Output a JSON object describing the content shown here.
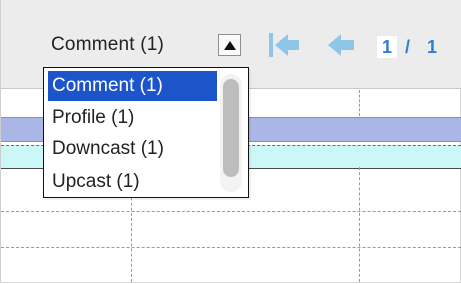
{
  "toolbar": {
    "filter_select": {
      "value": "Comment (1)"
    },
    "nav": {
      "current_page": "1",
      "separator": "/",
      "total_pages": "1"
    }
  },
  "dropdown": {
    "options": [
      "Comment (1)",
      "Profile (1)",
      "Downcast (1)",
      "Upcast (1)"
    ],
    "selected_index": 0
  },
  "colors": {
    "header_row": "#aab6e6",
    "highlight_row": "#ccf7f7",
    "selected_option": "#1b55c9",
    "page_text": "#2f7fd1",
    "nav_icon": "#8fc6e8"
  },
  "icons": [
    "chevron-up-icon",
    "first-page-icon",
    "previous-page-icon"
  ]
}
